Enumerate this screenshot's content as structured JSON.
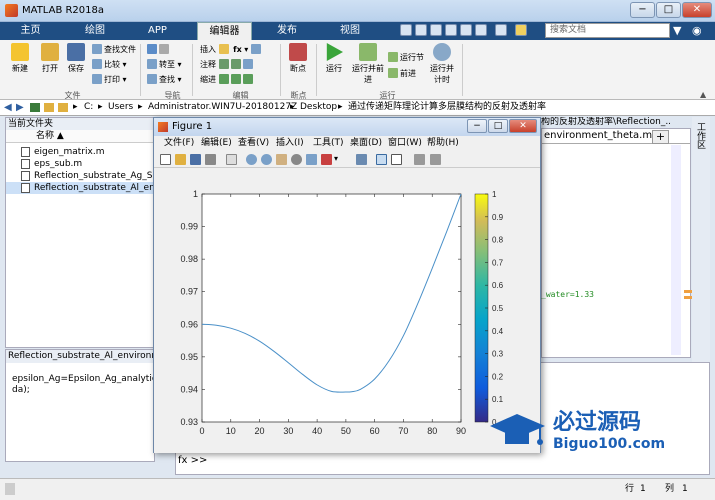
{
  "window": {
    "title": "MATLAB R2018a",
    "min": "−",
    "max": "□",
    "close": "✕"
  },
  "tabs": [
    "主页",
    "绘图",
    "APP",
    "编辑器",
    "发布",
    "视图"
  ],
  "search_placeholder": "搜索文档",
  "ribbon": {
    "file_group": {
      "new": "新建",
      "open": "打开",
      "save": "保存",
      "find_files": "查找文件",
      "compare": "比较",
      "print": "打印",
      "label": "文件"
    },
    "nav_group": {
      "goto": "转至",
      "find": "查找",
      "label": "导航"
    },
    "edit_group": {
      "insert": "插入",
      "comment": "注释",
      "indent": "缩进",
      "fx": "fx",
      "label": "编辑"
    },
    "bp_group": {
      "breakpoints": "断点",
      "label": "断点"
    },
    "run_group": {
      "run": "运行",
      "run_advance": "运行并前进",
      "run_section": "运行节",
      "advance": "前进",
      "run_time": "运行并计时",
      "label": "运行"
    }
  },
  "address": {
    "parts": [
      "C:",
      "Users",
      "Administrator.WIN7U-20180127Z",
      "Desktop",
      "通过传递矩阵理论计算多层膜结构的反射及透射率"
    ],
    "sep": "▸"
  },
  "current_folder": {
    "title": "当前文件夹",
    "column": "名称 ▲",
    "files": [
      {
        "name": "eigen_matrix.m",
        "selected": false
      },
      {
        "name": "eps_sub.m",
        "selected": false
      },
      {
        "name": "Reflection_substrate_Ag_SiO2_e",
        "selected": false
      },
      {
        "name": "Reflection_substrate_Al_environ",
        "selected": true
      }
    ]
  },
  "details": {
    "title": "Reflection_substrate_Al_environme...",
    "text1": "epsilon_Ag=Epsilon_Ag_analytical(la",
    "text2": "da);"
  },
  "editor": {
    "path": "构的反射及透射率\\Reflection_...",
    "tab": "environment_theta.m",
    "plus": "+",
    "code": "_water=1.33"
  },
  "side_label": "工作区",
  "command": {
    "prompt": "fx >>"
  },
  "status": {
    "row_label": "行",
    "row": "1",
    "col_label": "列",
    "col": "1"
  },
  "figure": {
    "title": "Figure 1",
    "menu": [
      "文件(F)",
      "编辑(E)",
      "查看(V)",
      "插入(I)",
      "工具(T)",
      "桌面(D)",
      "窗口(W)",
      "帮助(H)"
    ]
  },
  "chart_data": {
    "type": "line",
    "title": "",
    "xlabel": "",
    "ylabel": "",
    "xlim": [
      0,
      90
    ],
    "ylim": [
      0.93,
      1
    ],
    "xticks": [
      0,
      10,
      20,
      30,
      40,
      50,
      60,
      70,
      80,
      90
    ],
    "yticks": [
      0.93,
      0.94,
      0.95,
      0.96,
      0.97,
      0.98,
      0.99,
      1
    ],
    "ytick_labels": [
      "0.93",
      "0.94",
      "0.95",
      "0.96",
      "0.97",
      "0.98",
      "0.99",
      "1"
    ],
    "series": [
      {
        "color": "#4a90c8",
        "x": [
          0,
          5,
          10,
          15,
          20,
          25,
          30,
          35,
          40,
          45,
          50,
          52,
          55,
          60,
          65,
          70,
          75,
          80,
          85,
          90
        ],
        "y": [
          0.96,
          0.9597,
          0.9588,
          0.9572,
          0.9548,
          0.9517,
          0.9482,
          0.9446,
          0.9414,
          0.9394,
          0.9392,
          0.9393,
          0.94,
          0.9432,
          0.9488,
          0.9565,
          0.9664,
          0.9772,
          0.9884,
          1.0
        ]
      }
    ],
    "colorbar": {
      "min": 0,
      "max": 1,
      "ticks": [
        "0",
        "0.1",
        "0.2",
        "0.3",
        "0.4",
        "0.5",
        "0.6",
        "0.7",
        "0.8",
        "0.9",
        "1"
      ]
    },
    "grid": false
  },
  "watermark": {
    "text": "必过源码",
    "url": "Biguo100.com"
  }
}
